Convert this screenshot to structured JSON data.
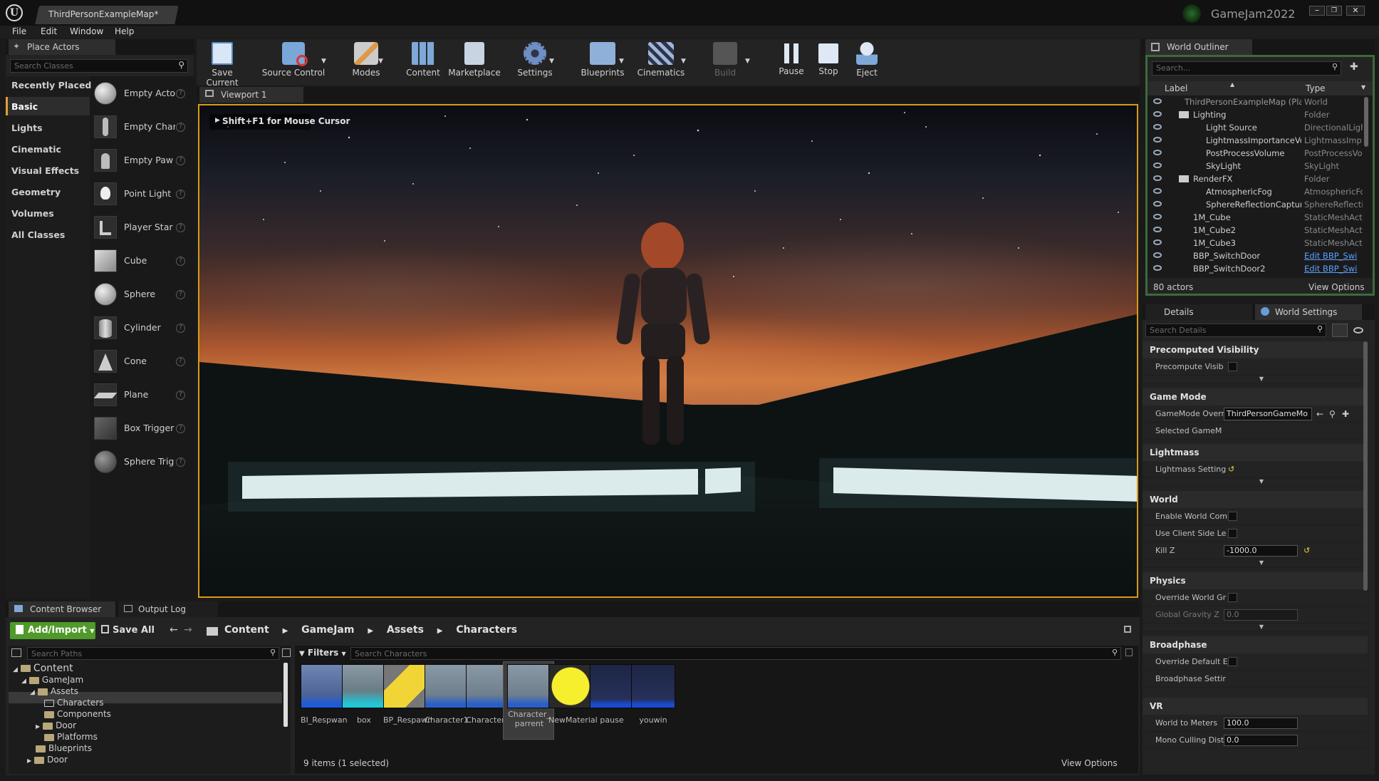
{
  "window": {
    "tab_title": "ThirdPersonExampleMap*",
    "project_name": "GameJam2022",
    "controls": [
      "minimize",
      "maximize",
      "close"
    ]
  },
  "menu": [
    "File",
    "Edit",
    "Window",
    "Help"
  ],
  "place_actors": {
    "tab_label": "Place Actors",
    "search_placeholder": "Search Classes",
    "categories": [
      "Recently Placed",
      "Basic",
      "Lights",
      "Cinematic",
      "Visual Effects",
      "Geometry",
      "Volumes",
      "All Classes"
    ],
    "selected_category": "Basic",
    "items": [
      "Empty Acto",
      "Empty Char",
      "Empty Paw",
      "Point Light",
      "Player Star",
      "Cube",
      "Sphere",
      "Cylinder",
      "Cone",
      "Plane",
      "Box Trigger",
      "Sphere Trig"
    ],
    "help_glyph": "?"
  },
  "toolbar": {
    "buttons": [
      "Save Current",
      "Source Control",
      "Modes",
      "Content",
      "Marketplace",
      "Settings",
      "Blueprints",
      "Cinematics",
      "Build",
      "Pause",
      "Stop",
      "Eject"
    ]
  },
  "viewport": {
    "tab_label": "Viewport 1",
    "hint": "Shift+F1 for Mouse Cursor"
  },
  "world_outliner": {
    "tab_label": "World Outliner",
    "search_placeholder": "Search...",
    "col_label": "Label",
    "col_type": "Type",
    "rows": [
      {
        "label": "ThirdPersonExampleMap (Pla",
        "type": "World"
      },
      {
        "label": "Lighting",
        "type": "Folder"
      },
      {
        "label": "Light Source",
        "type": "DirectionalLigh"
      },
      {
        "label": "LightmassImportanceVo",
        "type": "LightmassImp"
      },
      {
        "label": "PostProcessVolume",
        "type": "PostProcessVo"
      },
      {
        "label": "SkyLight",
        "type": "SkyLight"
      },
      {
        "label": "RenderFX",
        "type": "Folder"
      },
      {
        "label": "AtmosphericFog",
        "type": "AtmosphericFo"
      },
      {
        "label": "SphereReflectionCapture",
        "type": "SphereReflecti"
      },
      {
        "label": "1M_Cube",
        "type": "StaticMeshAct"
      },
      {
        "label": "1M_Cube2",
        "type": "StaticMeshAct"
      },
      {
        "label": "1M_Cube3",
        "type": "StaticMeshAct"
      },
      {
        "label": "BBP_SwitchDoor",
        "type": "Edit BBP_Swi"
      },
      {
        "label": "BBP_SwitchDoor2",
        "type": "Edit BBP_Swi"
      }
    ],
    "actor_count": "80 actors",
    "view_options": "View Options"
  },
  "details": {
    "tab_details": "Details",
    "tab_world_settings": "World Settings",
    "search_placeholder": "Search Details",
    "sections": {
      "precomputed_visibility": "Precomputed Visibility",
      "precompute_visib": "Precompute Visib",
      "game_mode": "Game Mode",
      "gamemode_override": "GameMode Overr",
      "gamemode_value": "ThirdPersonGameMo",
      "selected_gamemode": "Selected GameM",
      "lightmass": "Lightmass",
      "lightmass_settings": "Lightmass Setting",
      "world": "World",
      "enable_world_comp": "Enable World Com",
      "use_client_side": "Use Client Side Le",
      "kill_z": "Kill Z",
      "kill_z_value": "-1000.0",
      "physics": "Physics",
      "override_world_gravity": "Override World Gr",
      "global_gravity_z": "Global Gravity Z",
      "global_gravity_value": "0.0",
      "broadphase": "Broadphase",
      "override_default": "Override Default E",
      "broadphase_settings": "Broadphase Settir",
      "vr": "VR",
      "world_to_meters": "World to Meters",
      "world_to_meters_value": "100.0",
      "mono_culling": "Mono Culling Dist",
      "mono_culling_value": "0.0"
    }
  },
  "content_browser": {
    "tab_label": "Content Browser",
    "output_log_label": "Output Log",
    "add_import": "Add/Import",
    "save_all": "Save All",
    "breadcrumb": [
      "Content",
      "GameJam",
      "Assets",
      "Characters"
    ],
    "search_paths_placeholder": "Search Paths",
    "filters_label": "Filters",
    "search_placeholder": "Search Characters",
    "tree": [
      {
        "name": "Content",
        "depth": 0
      },
      {
        "name": "GameJam",
        "depth": 1
      },
      {
        "name": "Assets",
        "depth": 2
      },
      {
        "name": "Characters",
        "depth": 3
      },
      {
        "name": "Components",
        "depth": 3
      },
      {
        "name": "Door",
        "depth": 3
      },
      {
        "name": "Platforms",
        "depth": 3
      },
      {
        "name": "Blueprints",
        "depth": 2
      },
      {
        "name": "Door",
        "depth": 2
      }
    ],
    "assets": [
      "BI_Respwan",
      "box",
      "BP_Respawn",
      "Character1",
      "Character2",
      "Character_parrent",
      "NewMaterial",
      "pause",
      "youwin"
    ],
    "status": "9 items (1 selected)",
    "view_options": "View Options"
  }
}
